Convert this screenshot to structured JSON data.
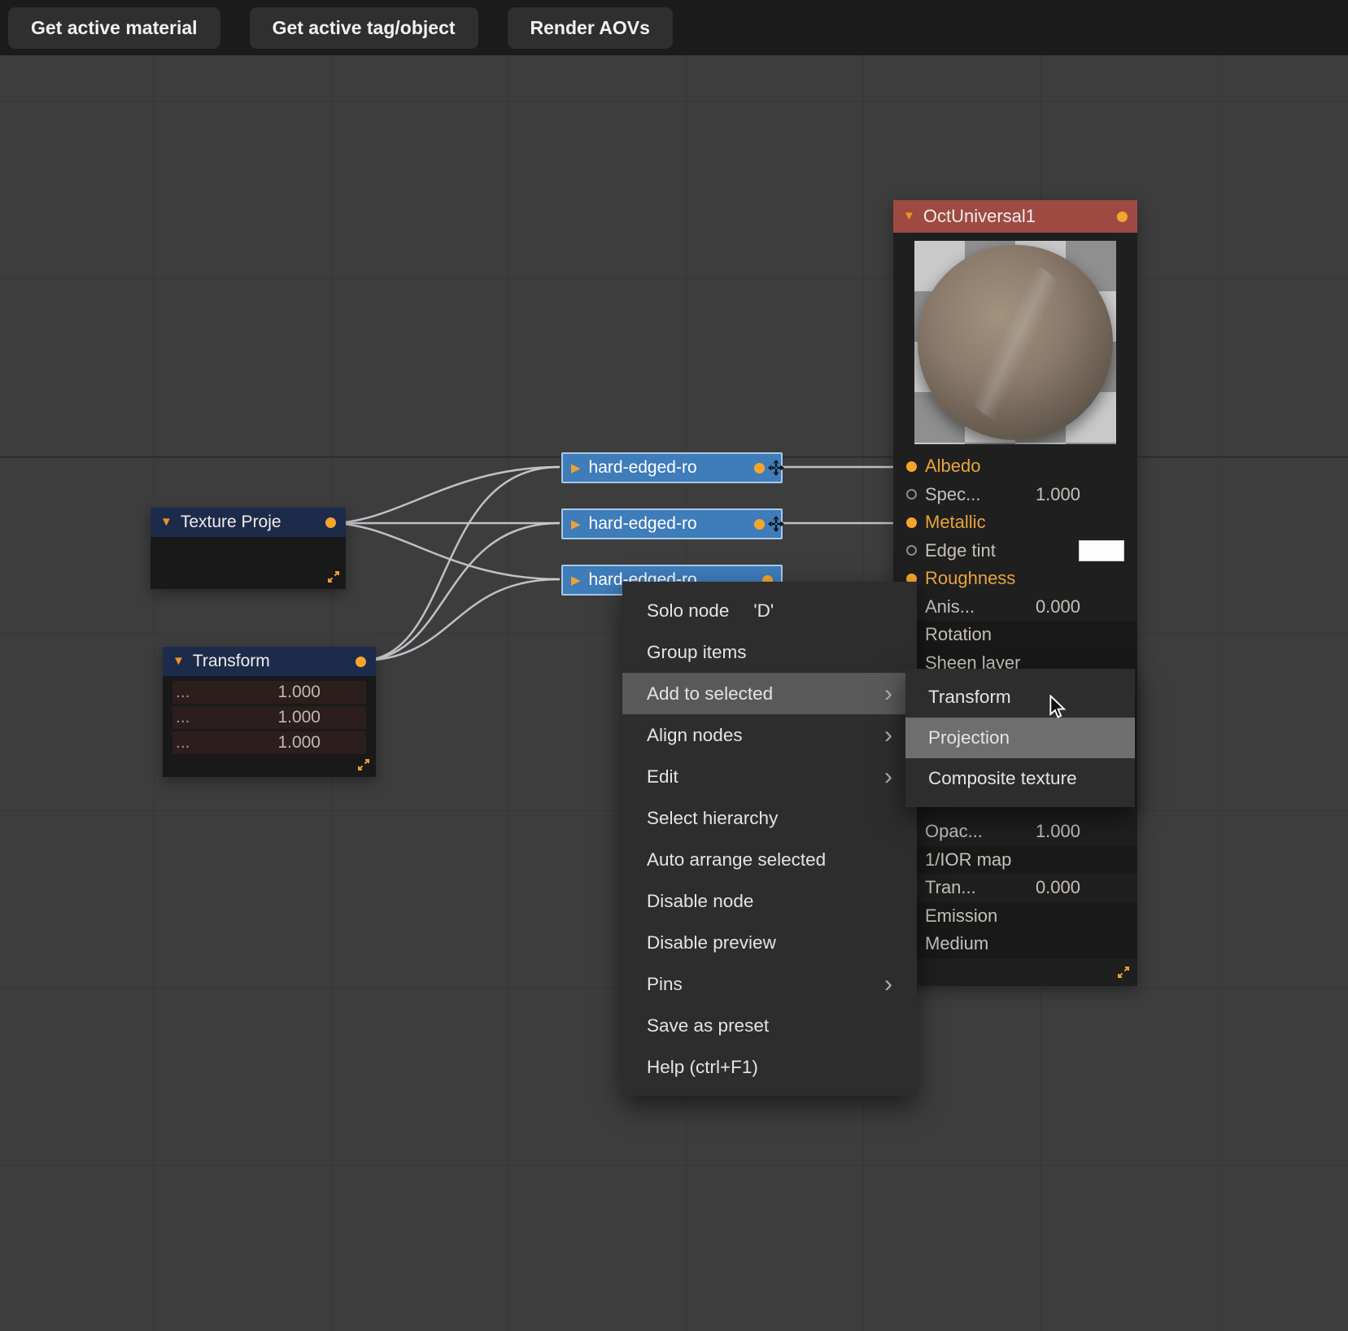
{
  "toolbar": {
    "buttons": [
      {
        "label": "Get active material"
      },
      {
        "label": "Get active tag/object"
      },
      {
        "label": "Render AOVs"
      }
    ]
  },
  "material_node": {
    "title": "OctUniversal1",
    "params": [
      {
        "label": "Albedo",
        "value": ""
      },
      {
        "label": "Spec...",
        "value": "1.000"
      },
      {
        "label": "Metallic",
        "value": ""
      },
      {
        "label": "Edge tint",
        "value": ""
      },
      {
        "label": "Roughness",
        "value": ""
      },
      {
        "label": "Anis...",
        "value": "0.000"
      },
      {
        "label": "Rotation",
        "value": ""
      },
      {
        "label": "Sheen layer",
        "value": ""
      }
    ],
    "params_lower": [
      {
        "label": "Opac...",
        "value": "1.000"
      },
      {
        "label": "1/IOR map",
        "value": ""
      },
      {
        "label": "Tran...",
        "value": "0.000"
      },
      {
        "label": "Emission",
        "value": ""
      },
      {
        "label": "Medium",
        "value": ""
      }
    ]
  },
  "texture_projection_node": {
    "title": "Texture Proje"
  },
  "transform_node": {
    "title": "Transform",
    "rows": [
      {
        "label": "...",
        "value": "1.000"
      },
      {
        "label": "...",
        "value": "1.000"
      },
      {
        "label": "...",
        "value": "1.000"
      }
    ]
  },
  "texture_nodes": [
    {
      "label": "hard-edged-ro"
    },
    {
      "label": "hard-edged-ro"
    },
    {
      "label": "hard-edged-ro"
    }
  ],
  "context_menu": {
    "items": [
      {
        "label": "Solo node",
        "shortcut": "'D'"
      },
      {
        "label": "Group items"
      },
      {
        "label": "Add to selected",
        "has_submenu": true,
        "highlighted": true
      },
      {
        "label": "Align nodes",
        "has_submenu": true
      },
      {
        "label": "Edit",
        "has_submenu": true
      },
      {
        "label": "Select hierarchy"
      },
      {
        "label": "Auto arrange selected"
      },
      {
        "label": "Disable node"
      },
      {
        "label": "Disable preview"
      },
      {
        "label": "Pins",
        "has_submenu": true
      },
      {
        "label": "Save as preset"
      },
      {
        "label": "Help (ctrl+F1)"
      }
    ]
  },
  "submenu": {
    "items": [
      {
        "label": "Transform"
      },
      {
        "label": "Projection",
        "highlighted": true
      },
      {
        "label": "Composite texture"
      }
    ]
  },
  "colors": {
    "accent_orange": "#f0a12e",
    "material_header": "#9e4a43",
    "blue_node_header": "#1d2b4b",
    "texture_node_blue": "#3e7cba",
    "menu_highlight": "#595959",
    "submenu_highlight": "#6e6e6e",
    "wire": "#c9ccd1"
  }
}
